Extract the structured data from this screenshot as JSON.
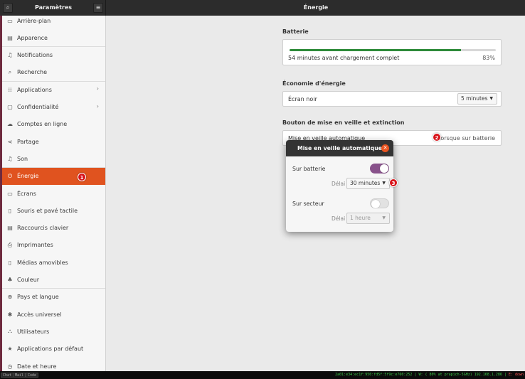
{
  "header": {
    "left_title": "Paramètres",
    "right_title": "Énergie",
    "search_glyph": "⌕",
    "menu_glyph": "≡"
  },
  "sidebar": {
    "items": [
      {
        "label": "Arrière-plan",
        "icon": "display-icon",
        "glyph": "▭"
      },
      {
        "label": "Apparence",
        "icon": "appearance-icon",
        "glyph": "▤"
      },
      {
        "label": "Notifications",
        "icon": "bell-icon",
        "glyph": "♫"
      },
      {
        "label": "Recherche",
        "icon": "search-icon",
        "glyph": "⌕"
      },
      {
        "label": "Applications",
        "icon": "grid-icon",
        "glyph": "⁞⁞",
        "chevron": "›"
      },
      {
        "label": "Confidentialité",
        "icon": "lock-icon",
        "glyph": "▢",
        "chevron": "›"
      },
      {
        "label": "Comptes en ligne",
        "icon": "cloud-icon",
        "glyph": "☁"
      },
      {
        "label": "Partage",
        "icon": "share-icon",
        "glyph": "⋖"
      },
      {
        "label": "Son",
        "icon": "music-icon",
        "glyph": "♫"
      },
      {
        "label": "Énergie",
        "icon": "power-icon",
        "glyph": "⏻",
        "active": true
      },
      {
        "label": "Écrans",
        "icon": "monitor-icon",
        "glyph": "▭"
      },
      {
        "label": "Souris et pavé tactile",
        "icon": "mouse-icon",
        "glyph": "▯"
      },
      {
        "label": "Raccourcis clavier",
        "icon": "keyboard-icon",
        "glyph": "▤"
      },
      {
        "label": "Imprimantes",
        "icon": "printer-icon",
        "glyph": "⎙"
      },
      {
        "label": "Médias amovibles",
        "icon": "usb-icon",
        "glyph": "▯"
      },
      {
        "label": "Couleur",
        "icon": "color-icon",
        "glyph": "♣"
      },
      {
        "label": "Pays et langue",
        "icon": "globe-icon",
        "glyph": "⊕"
      },
      {
        "label": "Accès universel",
        "icon": "accessibility-icon",
        "glyph": "✱"
      },
      {
        "label": "Utilisateurs",
        "icon": "users-icon",
        "glyph": "⛬"
      },
      {
        "label": "Applications par défaut",
        "icon": "star-icon",
        "glyph": "★"
      },
      {
        "label": "Date et heure",
        "icon": "clock-icon",
        "glyph": "◷"
      }
    ]
  },
  "main": {
    "battery": {
      "title": "Batterie",
      "status": "54 minutes avant chargement complet",
      "percent": "83%",
      "level": 0.83
    },
    "power_saving": {
      "title": "Économie d'énergie",
      "blank_label": "Écran noir",
      "blank_value": "5 minutes"
    },
    "suspend_button": {
      "title": "Bouton de mise en veille et extinction",
      "auto_label": "Mise en veille automatique",
      "auto_value": "Lorsque sur batterie"
    }
  },
  "dialog": {
    "title": "Mise en veille automatique",
    "close_glyph": "✕",
    "on_battery_label": "Sur batterie",
    "on_battery_enabled": true,
    "delay_label_1": "Délai",
    "delay_value_1": "30 minutes",
    "on_ac_label": "Sur secteur",
    "on_ac_enabled": false,
    "delay_label_2": "Délai",
    "delay_value_2": "1 heure",
    "arrow_glyph": "▼"
  },
  "markers": [
    "1",
    "2",
    "3"
  ],
  "statusbar": {
    "tabs": [
      "Chat",
      "Mail",
      "Code"
    ],
    "right_text": "2a01:e34:ec1f:950:fd5f:5f9c:e760:252 | W: ( 80% at prapich-5GHz) 192.168.1.286 | ",
    "right_red": "E: down"
  },
  "colors": {
    "accent": "#e0531f",
    "toggle_on": "#88528b",
    "battery_bar": "#2e8b3a",
    "marker": "#d8141b"
  }
}
